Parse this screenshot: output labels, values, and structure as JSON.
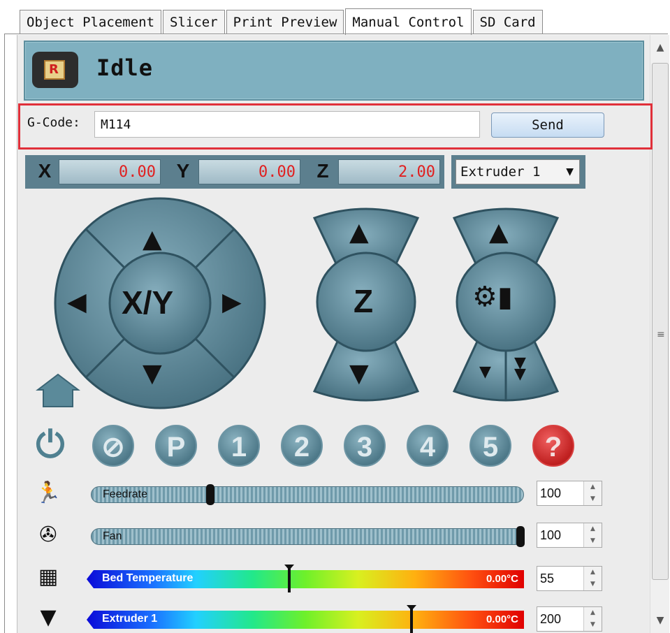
{
  "tabs": [
    {
      "label": "Object Placement"
    },
    {
      "label": "Slicer"
    },
    {
      "label": "Print Preview"
    },
    {
      "label": "Manual Control",
      "active": true
    },
    {
      "label": "SD Card"
    }
  ],
  "status": {
    "text": "Idle",
    "icon": "repetier-logo-icon"
  },
  "gcode": {
    "label": "G-Code:",
    "value": "M114",
    "send_label": "Send"
  },
  "coords": {
    "x_label": "X",
    "x_value": "0.00",
    "y_label": "Y",
    "y_value": "0.00",
    "z_label": "Z",
    "z_value": "2.00"
  },
  "extruder_select": {
    "selected": "Extruder 1"
  },
  "jog": {
    "xy_label": "X/Y",
    "z_label": "Z"
  },
  "quick_buttons": [
    {
      "name": "power-button",
      "label": "⏻"
    },
    {
      "name": "stop-motors-button",
      "label": "⊘"
    },
    {
      "name": "park-button",
      "label": "P"
    },
    {
      "name": "preset-1-button",
      "label": "1"
    },
    {
      "name": "preset-2-button",
      "label": "2"
    },
    {
      "name": "preset-3-button",
      "label": "3"
    },
    {
      "name": "preset-4-button",
      "label": "4"
    },
    {
      "name": "preset-5-button",
      "label": "5"
    },
    {
      "name": "help-button",
      "label": "?"
    }
  ],
  "sliders": {
    "feedrate": {
      "label": "Feedrate",
      "value": "100",
      "fraction": 0.27
    },
    "fan": {
      "label": "Fan",
      "value": "100",
      "fraction": 1.0
    },
    "bed": {
      "label": "Bed Temperature",
      "current": "0.00°C",
      "target": "55",
      "fraction": 0.46
    },
    "extruder": {
      "label": "Extruder 1",
      "current": "0.00°C",
      "target": "200",
      "fraction": 0.74
    }
  },
  "colors": {
    "accent": "#7fb0c0",
    "highlight_border": "#e0303a",
    "coord_value": "#e02020"
  }
}
